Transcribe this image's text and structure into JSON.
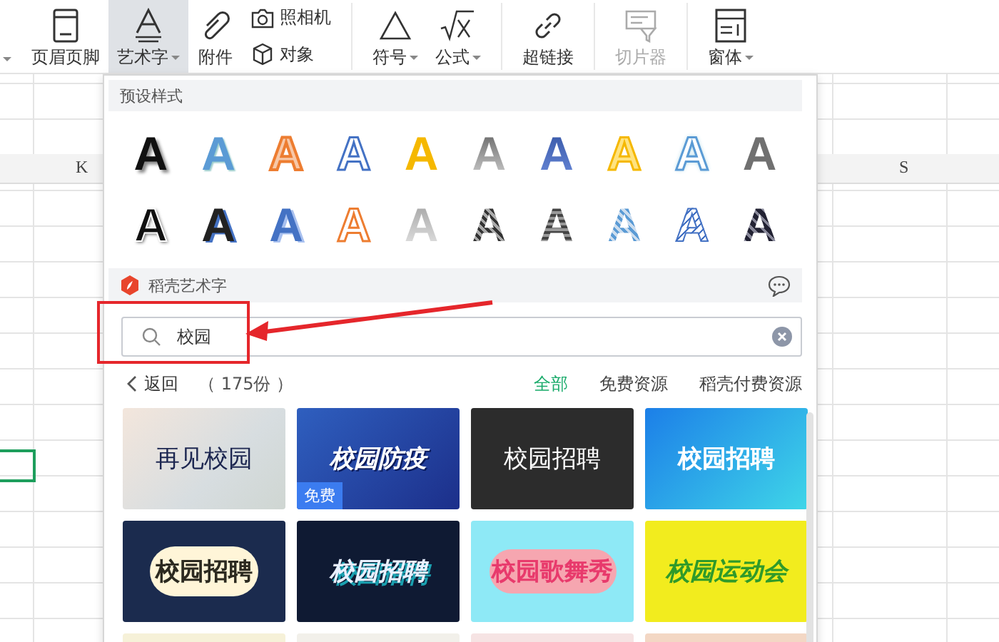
{
  "toolbar": {
    "items": [
      {
        "kind": "big",
        "label": "页眉页脚",
        "selected": false,
        "disabled": false,
        "caret": false
      },
      {
        "kind": "big",
        "label": "艺术字",
        "selected": true,
        "disabled": false,
        "caret": true
      },
      {
        "kind": "big",
        "label": "附件",
        "selected": false,
        "disabled": false,
        "caret": false
      },
      {
        "kind": "pair",
        "items": [
          {
            "label": "照相机"
          },
          {
            "label": "对象"
          }
        ]
      },
      {
        "kind": "sep"
      },
      {
        "kind": "big",
        "label": "符号",
        "selected": false,
        "disabled": false,
        "caret": true
      },
      {
        "kind": "big",
        "label": "公式",
        "selected": false,
        "disabled": false,
        "caret": true
      },
      {
        "kind": "sep"
      },
      {
        "kind": "big",
        "label": "超链接",
        "selected": false,
        "disabled": false,
        "caret": false
      },
      {
        "kind": "sep"
      },
      {
        "kind": "big",
        "label": "切片器",
        "selected": false,
        "disabled": true,
        "caret": false
      },
      {
        "kind": "sep"
      },
      {
        "kind": "big",
        "label": "窗体",
        "selected": false,
        "disabled": false,
        "caret": true
      }
    ]
  },
  "sheet": {
    "columns": [
      {
        "label": "K"
      },
      {
        "label": "S"
      }
    ]
  },
  "panel": {
    "preset_title": "预设样式",
    "presets": [
      {
        "letter": "A",
        "kind": "black-shadow"
      },
      {
        "letter": "A",
        "kind": "blue"
      },
      {
        "letter": "A",
        "kind": "orange-outline"
      },
      {
        "letter": "A",
        "kind": "blue-outline"
      },
      {
        "letter": "A",
        "kind": "gold"
      },
      {
        "letter": "A",
        "kind": "grey-fade"
      },
      {
        "letter": "A",
        "kind": "navy"
      },
      {
        "letter": "A",
        "kind": "yellow-outline"
      },
      {
        "letter": "A",
        "kind": "pale-blue"
      },
      {
        "letter": "A",
        "kind": "grey"
      },
      {
        "letter": "A",
        "kind": "black-outline"
      },
      {
        "letter": "A",
        "kind": "dark-blue-shadow"
      },
      {
        "letter": "A",
        "kind": "blue-shadow"
      },
      {
        "letter": "A",
        "kind": "orange-hollow"
      },
      {
        "letter": "A",
        "kind": "silver"
      },
      {
        "letter": "A",
        "kind": "dark-striped"
      },
      {
        "letter": "A",
        "kind": "grey-striped"
      },
      {
        "letter": "A",
        "kind": "blue-pattern"
      },
      {
        "letter": "A",
        "kind": "blue-hatched"
      },
      {
        "letter": "A",
        "kind": "navy-hatched"
      }
    ],
    "section_title": "稻壳艺术字",
    "search": {
      "value": "校园"
    },
    "back": "返回",
    "count": "（ 175份 ）",
    "filters": [
      {
        "label": "全部",
        "selected": true
      },
      {
        "label": "免费资源",
        "selected": false
      },
      {
        "label": "稻壳付费资源",
        "selected": false
      }
    ],
    "tiles": [
      {
        "kind": "classroom",
        "text": "再见校园"
      },
      {
        "kind": "blue",
        "text": "校园防疫",
        "badge": "免费"
      },
      {
        "kind": "chalk",
        "text": "校园招聘"
      },
      {
        "kind": "cyan",
        "text": "校园招聘"
      },
      {
        "kind": "navy-cloud",
        "text": "校园招聘"
      },
      {
        "kind": "dark",
        "text": "校园招聘"
      },
      {
        "kind": "pink",
        "text": "校园歌舞秀"
      },
      {
        "kind": "yellow",
        "text": "校园运动会"
      },
      {
        "kind": "cream"
      },
      {
        "kind": "paper"
      },
      {
        "kind": "blush"
      },
      {
        "kind": "peach"
      }
    ]
  }
}
